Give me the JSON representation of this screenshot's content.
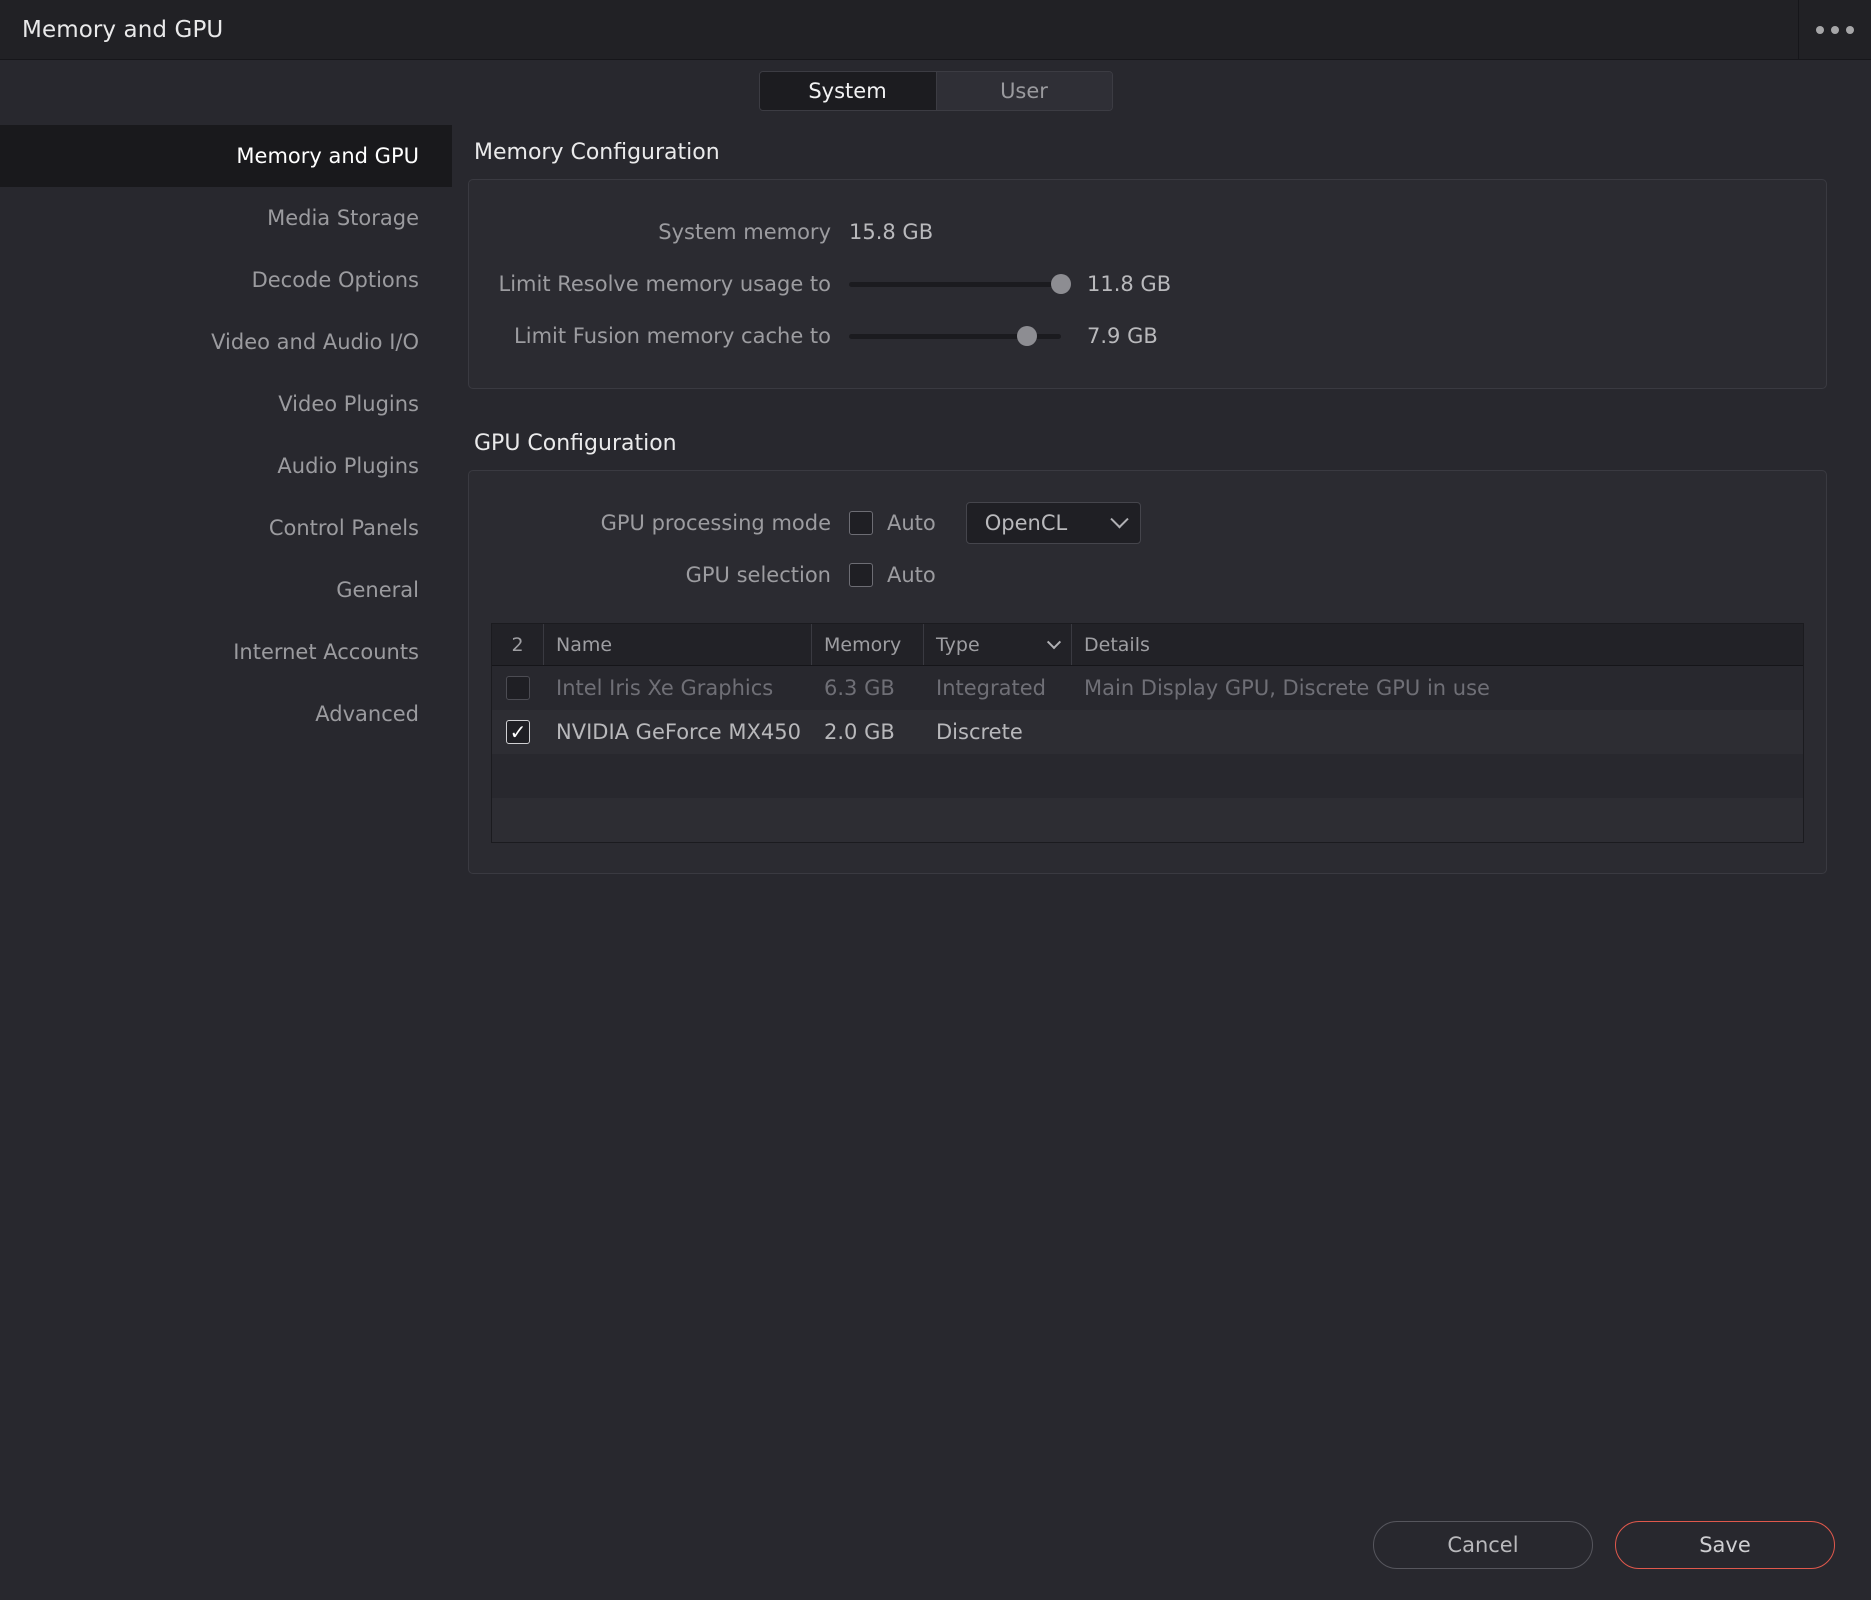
{
  "window": {
    "title": "Memory and GPU",
    "menu_icon": "ellipsis-icon"
  },
  "tabs": [
    {
      "label": "System",
      "active": true
    },
    {
      "label": "User",
      "active": false
    }
  ],
  "sidebar": {
    "items": [
      {
        "label": "Memory and GPU",
        "selected": true
      },
      {
        "label": "Media Storage",
        "selected": false
      },
      {
        "label": "Decode Options",
        "selected": false
      },
      {
        "label": "Video and Audio I/O",
        "selected": false
      },
      {
        "label": "Video Plugins",
        "selected": false
      },
      {
        "label": "Audio Plugins",
        "selected": false
      },
      {
        "label": "Control Panels",
        "selected": false
      },
      {
        "label": "General",
        "selected": false
      },
      {
        "label": "Internet Accounts",
        "selected": false
      },
      {
        "label": "Advanced",
        "selected": false
      }
    ]
  },
  "memory_configuration": {
    "heading": "Memory Configuration",
    "system_memory": {
      "label": "System memory",
      "value": "15.8 GB"
    },
    "resolve_limit": {
      "label": "Limit Resolve memory usage to",
      "value": "11.8 GB",
      "percent": 100
    },
    "fusion_limit": {
      "label": "Limit Fusion memory cache to",
      "value": "7.9 GB",
      "percent": 84
    }
  },
  "gpu_configuration": {
    "heading": "GPU Configuration",
    "processing_mode": {
      "label": "GPU processing mode",
      "auto_label": "Auto",
      "auto_checked": false,
      "mode_value": "OpenCL",
      "chevron": "chevron-down-icon"
    },
    "gpu_selection": {
      "label": "GPU selection",
      "auto_label": "Auto",
      "auto_checked": false
    },
    "table": {
      "columns": {
        "count": "2",
        "name": "Name",
        "memory": "Memory",
        "type": "Type",
        "details": "Details",
        "sort_icon": "chevron-down-icon"
      },
      "rows": [
        {
          "checked": false,
          "disabled": true,
          "name": "Intel Iris Xe Graphics",
          "memory": "6.3 GB",
          "type": "Integrated",
          "details": "Main Display GPU, Discrete GPU in use"
        },
        {
          "checked": true,
          "disabled": false,
          "name": "NVIDIA GeForce MX450",
          "memory": "2.0 GB",
          "type": "Discrete",
          "details": ""
        }
      ]
    }
  },
  "footer": {
    "cancel_label": "Cancel",
    "save_label": "Save",
    "save_accent": "#e0584c"
  }
}
